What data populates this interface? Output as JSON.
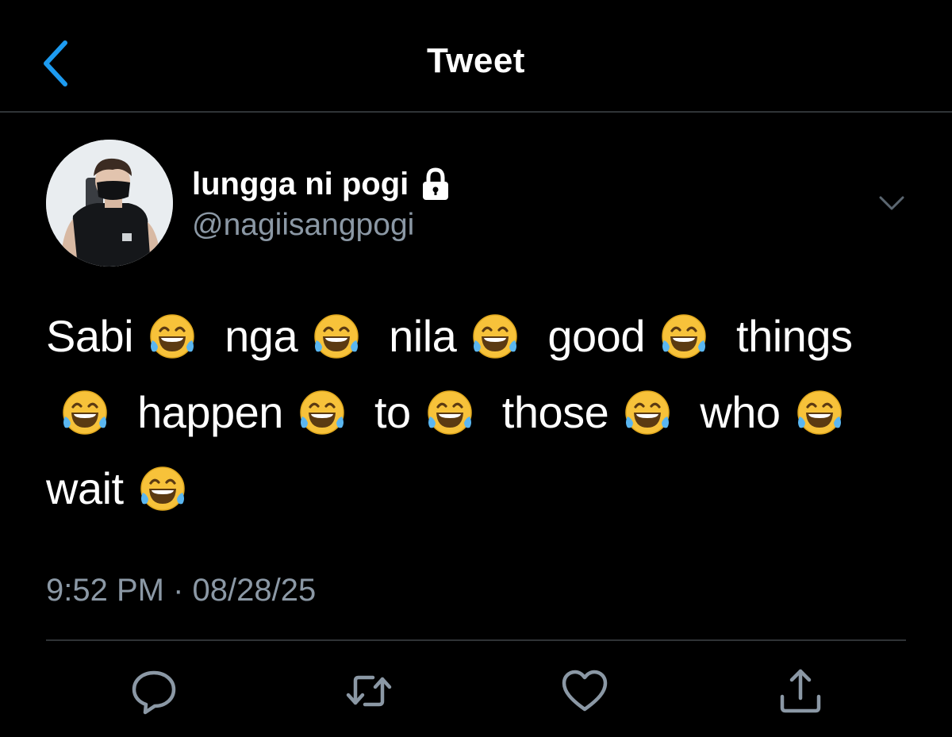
{
  "header": {
    "title": "Tweet",
    "back_icon": "chevron-left-icon",
    "accent_color": "#1d9bf0"
  },
  "author": {
    "display_name": "lungga ni pogi",
    "handle": "@nagiisangpogi",
    "protected_icon": "lock-icon",
    "avatar_icon": "profile-photo"
  },
  "tweet": {
    "words": [
      "Sabi",
      "nga",
      "nila",
      "good",
      "things",
      "happen",
      "to",
      "those",
      "who",
      "wait"
    ],
    "emoji": "😂",
    "emoji_name": "face-with-tears-of-joy-icon",
    "time": "9:52 PM",
    "separator": "·",
    "date": "08/28/25"
  },
  "actions": {
    "reply_icon": "reply-icon",
    "retweet_icon": "retweet-icon",
    "like_icon": "heart-icon",
    "share_icon": "share-icon",
    "icon_color": "#8b98a5"
  },
  "more_icon": "chevron-down-icon"
}
